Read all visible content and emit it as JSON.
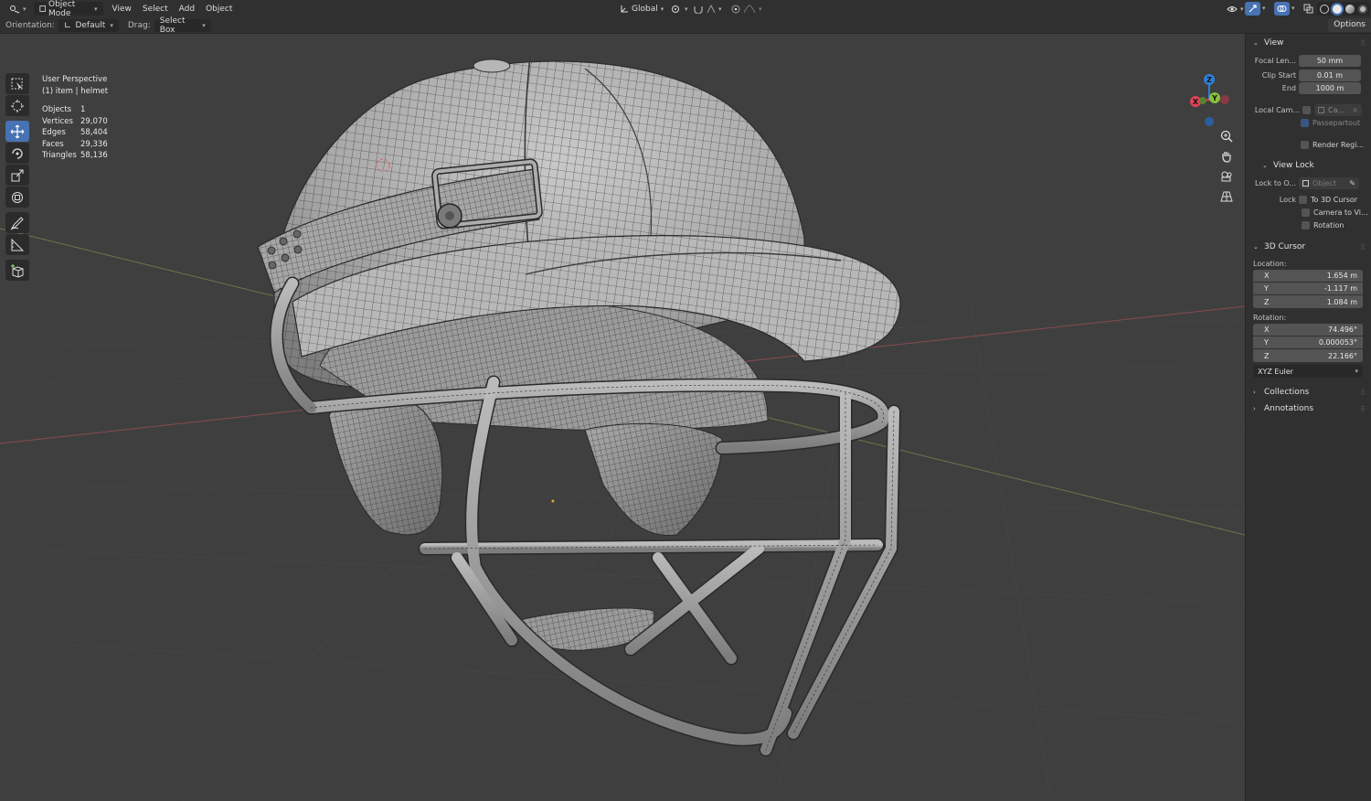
{
  "header": {
    "mode": "Object Mode",
    "menus": [
      "View",
      "Select",
      "Add",
      "Object"
    ],
    "transform_orientation": "Global",
    "options_label": "Options"
  },
  "tool_header": {
    "orientation_label": "Orientation:",
    "orientation_value": "Default",
    "drag_label": "Drag:",
    "drag_value": "Select Box"
  },
  "toolbar": {
    "tools": [
      "select-box",
      "cursor",
      "move",
      "rotate",
      "scale",
      "transform",
      "annotate",
      "measure",
      "add-cube"
    ],
    "active": "move"
  },
  "overlay": {
    "view_name": "User Perspective",
    "context": "(1) item | helmet",
    "stats": [
      {
        "label": "Objects",
        "value": "1"
      },
      {
        "label": "Vertices",
        "value": "29,070"
      },
      {
        "label": "Edges",
        "value": "58,404"
      },
      {
        "label": "Faces",
        "value": "29,336"
      },
      {
        "label": "Triangles",
        "value": "58,136"
      }
    ]
  },
  "gizmo": {
    "z": "Z",
    "y": "Y",
    "x": "X"
  },
  "sidebar": {
    "view": {
      "title": "View",
      "focal_length_label": "Focal Len...",
      "focal_length": "50 mm",
      "clip_start_label": "Clip Start",
      "clip_start": "0.01 m",
      "clip_end_label": "End",
      "clip_end": "1000 m",
      "local_camera_label": "Local Cam...",
      "local_camera_value": "Ca...",
      "passepartout": "Passepartout",
      "render_region": "Render Regi..."
    },
    "view_lock": {
      "title": "View Lock",
      "lock_to_object_label": "Lock to O...",
      "lock_to_object_placeholder": "Object",
      "lock_label": "Lock",
      "to_3d_cursor": "To 3D Cursor",
      "camera_to_view": "Camera to Vi...",
      "rotation": "Rotation"
    },
    "cursor": {
      "title": "3D Cursor",
      "location_label": "Location:",
      "location": [
        {
          "axis": "X",
          "value": "1.654 m"
        },
        {
          "axis": "Y",
          "value": "-1.117 m"
        },
        {
          "axis": "Z",
          "value": "1.084 m"
        }
      ],
      "rotation_label": "Rotation:",
      "rotation": [
        {
          "axis": "X",
          "value": "74.496°"
        },
        {
          "axis": "Y",
          "value": "0.000053°"
        },
        {
          "axis": "Z",
          "value": "22.166°"
        }
      ],
      "rotation_mode": "XYZ Euler"
    },
    "collections": "Collections",
    "annotations": "Annotations"
  },
  "colors": {
    "active_tool": "#4772b3",
    "axis_x": "#e0425a",
    "axis_y": "#86c13d",
    "axis_z": "#2f7fd6",
    "viewport_bg": "#3f3f3f"
  }
}
